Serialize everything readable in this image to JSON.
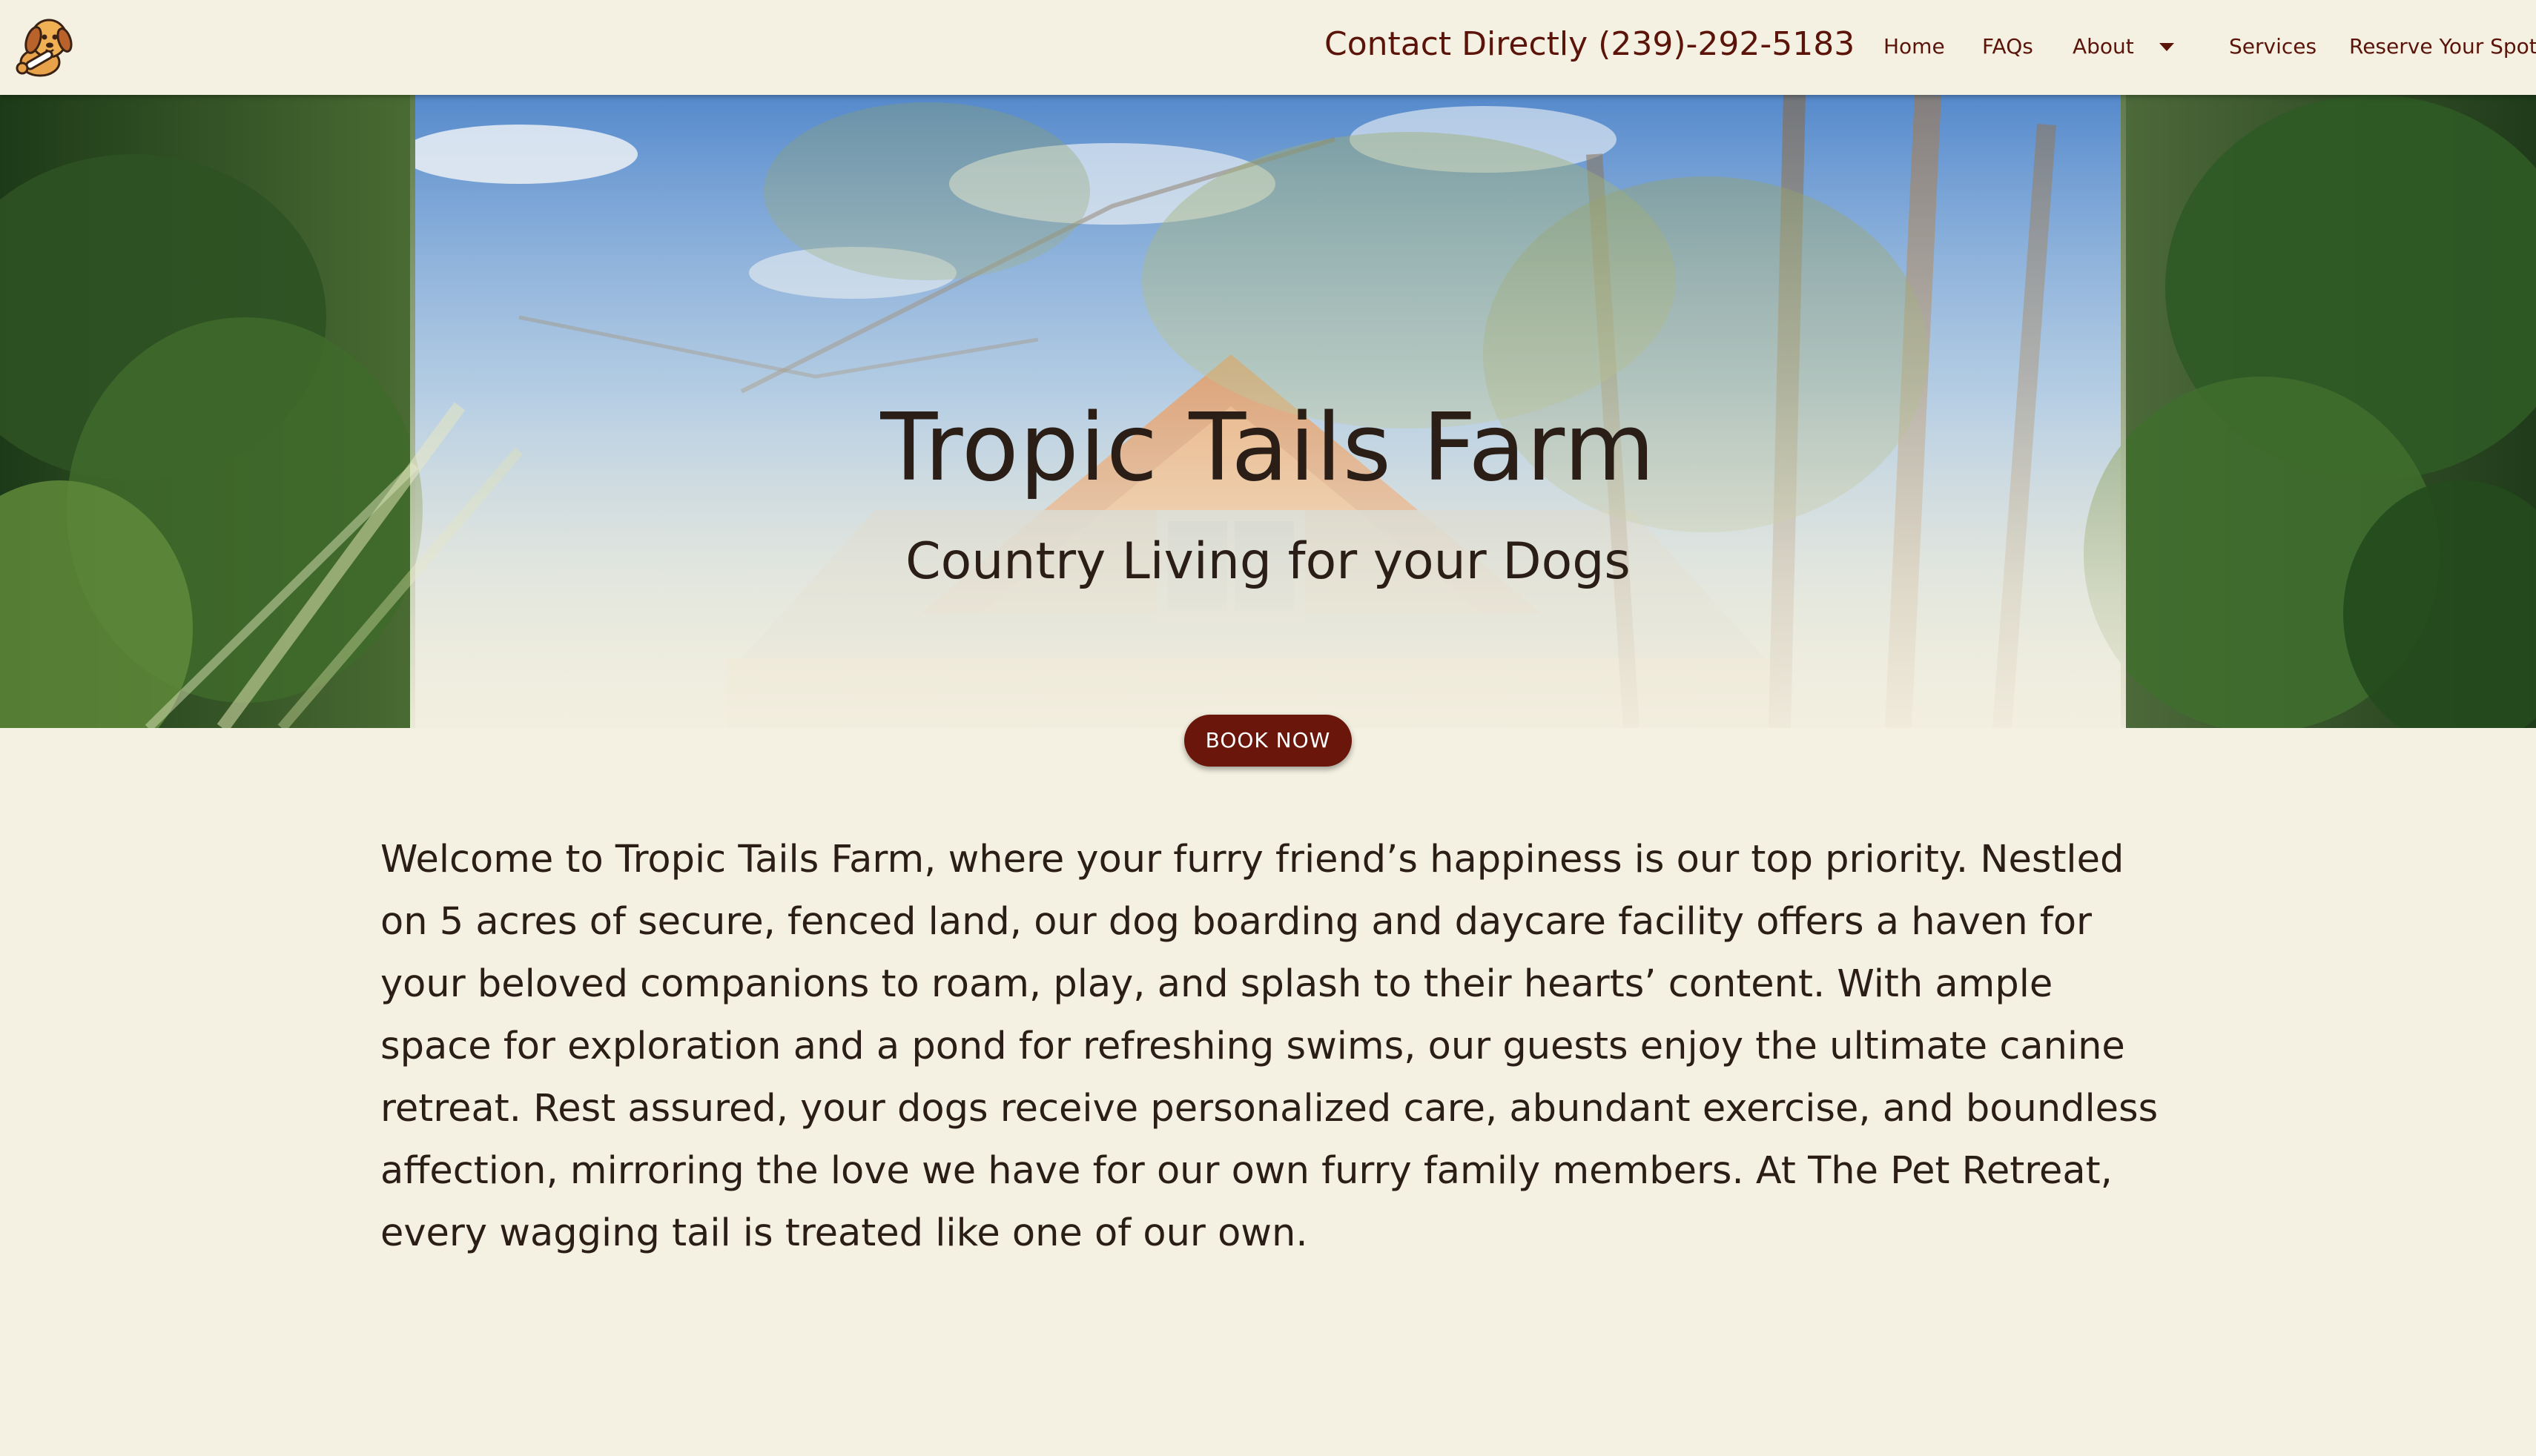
{
  "header": {
    "contact_text": "Contact Directly (239)-292-5183",
    "nav": {
      "home": "Home",
      "faqs": "FAQs",
      "about": "About",
      "services": "Services",
      "reserve": "Reserve Your Spot"
    }
  },
  "hero": {
    "title": "Tropic Tails Farm",
    "subtitle": "Country Living for your Dogs",
    "cta_label": "BOOK NOW"
  },
  "main": {
    "welcome_text": "Welcome to Tropic Tails Farm, where your furry friend’s happiness is our top priority. Nestled on 5 acres of secure, fenced land, our dog boarding and daycare facility offers a haven for your beloved companions to roam, play, and splash to their hearts’ content. With ample space for exploration and a pond for refreshing swims, our guests enjoy the ultimate canine retreat. Rest assured, your dogs receive personalized care, abundant exercise, and boundless affection, mirroring the love we have for our own furry family members. At The Pet Retreat, every wagging tail is treated like one of our own."
  },
  "colors": {
    "background": "#f5f1e2",
    "accent": "#5b140a",
    "button": "#6a160b",
    "text": "#2a1e17"
  },
  "icons": {
    "logo": "dog-logo-icon",
    "dropdown": "caret-down-icon"
  }
}
